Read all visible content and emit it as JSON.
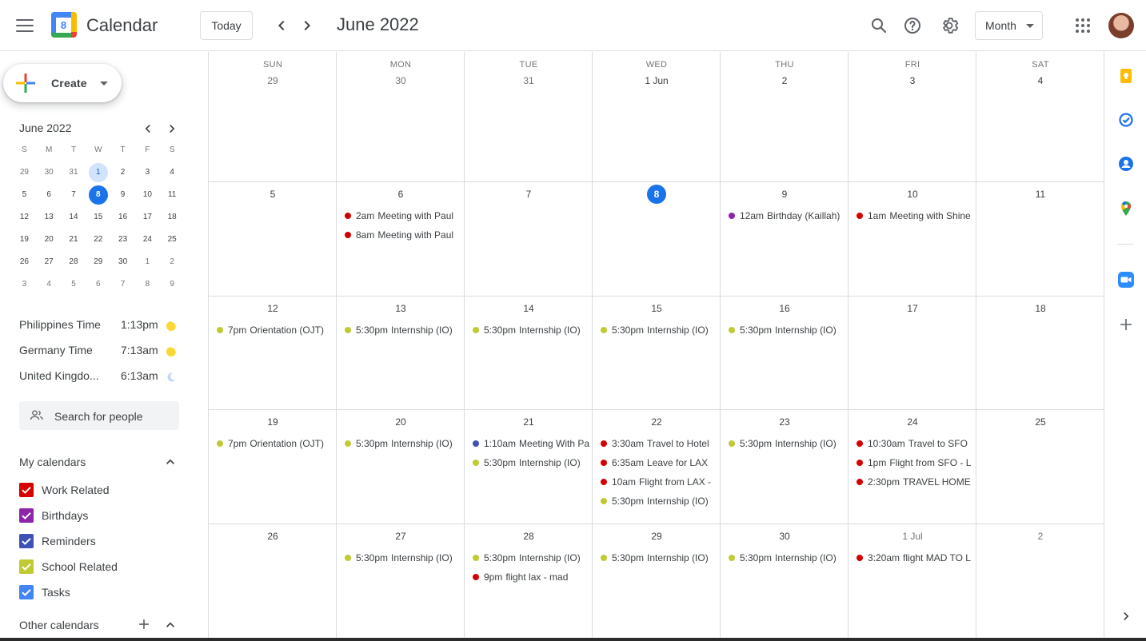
{
  "header": {
    "app_title": "Calendar",
    "logo_day": "8",
    "today_label": "Today",
    "month_title": "June 2022",
    "view_label": "Month"
  },
  "sidebar": {
    "create_label": "Create",
    "mini_calendar": {
      "title": "June 2022",
      "weekdays": [
        "S",
        "M",
        "T",
        "W",
        "T",
        "F",
        "S"
      ],
      "weeks": [
        [
          "29",
          "30",
          "31",
          "1",
          "2",
          "3",
          "4"
        ],
        [
          "5",
          "6",
          "7",
          "8",
          "9",
          "10",
          "11"
        ],
        [
          "12",
          "13",
          "14",
          "15",
          "16",
          "17",
          "18"
        ],
        [
          "19",
          "20",
          "21",
          "22",
          "23",
          "24",
          "25"
        ],
        [
          "26",
          "27",
          "28",
          "29",
          "30",
          "1",
          "2"
        ],
        [
          "3",
          "4",
          "5",
          "6",
          "7",
          "8",
          "9"
        ]
      ],
      "selected": "1",
      "today": "8"
    },
    "time_zones": [
      {
        "name": "Philippines Time",
        "time": "1:13pm",
        "icon": "sun-icon"
      },
      {
        "name": "Germany Time",
        "time": "7:13am",
        "icon": "sun-icon"
      },
      {
        "name": "United Kingdo...",
        "time": "6:13am",
        "icon": "moon-icon"
      }
    ],
    "search_people_placeholder": "Search for people",
    "my_calendars_title": "My calendars",
    "my_calendars": [
      {
        "name": "Work Related",
        "color": "#d50000"
      },
      {
        "name": "Birthdays",
        "color": "#8e24aa"
      },
      {
        "name": "Reminders",
        "color": "#3f51b5"
      },
      {
        "name": "School Related",
        "color": "#c0ca33"
      },
      {
        "name": "Tasks",
        "color": "#4285f4"
      }
    ],
    "other_calendars_title": "Other calendars"
  },
  "calendar": {
    "weekdays": [
      "SUN",
      "MON",
      "TUE",
      "WED",
      "THU",
      "FRI",
      "SAT"
    ],
    "weeks": [
      {
        "days": [
          {
            "label": "29",
            "other": true,
            "events": []
          },
          {
            "label": "30",
            "other": true,
            "events": []
          },
          {
            "label": "31",
            "other": true,
            "events": []
          },
          {
            "label": "1 Jun",
            "events": []
          },
          {
            "label": "2",
            "events": []
          },
          {
            "label": "3",
            "events": []
          },
          {
            "label": "4",
            "events": []
          }
        ]
      },
      {
        "days": [
          {
            "label": "5",
            "events": []
          },
          {
            "label": "6",
            "events": [
              {
                "time": "2am",
                "title": "Meeting with Paul",
                "color": "#d50000"
              },
              {
                "time": "8am",
                "title": "Meeting with Paul",
                "color": "#d50000"
              }
            ]
          },
          {
            "label": "7",
            "events": []
          },
          {
            "label": "8",
            "today": true,
            "events": []
          },
          {
            "label": "9",
            "events": [
              {
                "time": "12am",
                "title": "Birthday (Kaillah)",
                "color": "#8e24aa"
              }
            ]
          },
          {
            "label": "10",
            "events": [
              {
                "time": "1am",
                "title": "Meeting with Shine",
                "color": "#d50000"
              }
            ]
          },
          {
            "label": "11",
            "events": []
          }
        ]
      },
      {
        "days": [
          {
            "label": "12",
            "events": [
              {
                "time": "7pm",
                "title": "Orientation (OJT)",
                "color": "#c0ca33"
              }
            ]
          },
          {
            "label": "13",
            "events": [
              {
                "time": "5:30pm",
                "title": "Internship (IO)",
                "color": "#c0ca33"
              }
            ]
          },
          {
            "label": "14",
            "events": [
              {
                "time": "5:30pm",
                "title": "Internship (IO)",
                "color": "#c0ca33"
              }
            ]
          },
          {
            "label": "15",
            "events": [
              {
                "time": "5:30pm",
                "title": "Internship (IO)",
                "color": "#c0ca33"
              }
            ]
          },
          {
            "label": "16",
            "events": [
              {
                "time": "5:30pm",
                "title": "Internship (IO)",
                "color": "#c0ca33"
              }
            ]
          },
          {
            "label": "17",
            "events": []
          },
          {
            "label": "18",
            "events": []
          }
        ]
      },
      {
        "days": [
          {
            "label": "19",
            "events": [
              {
                "time": "7pm",
                "title": "Orientation (OJT)",
                "color": "#c0ca33"
              }
            ]
          },
          {
            "label": "20",
            "events": [
              {
                "time": "5:30pm",
                "title": "Internship (IO)",
                "color": "#c0ca33"
              }
            ]
          },
          {
            "label": "21",
            "events": [
              {
                "time": "1:10am",
                "title": "Meeting With Pa",
                "color": "#3f51b5"
              },
              {
                "time": "5:30pm",
                "title": "Internship (IO)",
                "color": "#c0ca33"
              }
            ]
          },
          {
            "label": "22",
            "events": [
              {
                "time": "3:30am",
                "title": "Travel to Hotel",
                "color": "#d50000"
              },
              {
                "time": "6:35am",
                "title": "Leave for LAX",
                "color": "#d50000"
              },
              {
                "time": "10am",
                "title": "Flight from LAX -",
                "color": "#d50000"
              },
              {
                "time": "5:30pm",
                "title": "Internship (IO)",
                "color": "#c0ca33"
              }
            ]
          },
          {
            "label": "23",
            "events": [
              {
                "time": "5:30pm",
                "title": "Internship (IO)",
                "color": "#c0ca33"
              }
            ]
          },
          {
            "label": "24",
            "events": [
              {
                "time": "10:30am",
                "title": "Travel to SFO",
                "color": "#d50000"
              },
              {
                "time": "1pm",
                "title": "Flight from SFO - L",
                "color": "#d50000"
              },
              {
                "time": "2:30pm",
                "title": "TRAVEL HOME",
                "color": "#d50000"
              }
            ]
          },
          {
            "label": "25",
            "events": []
          }
        ]
      },
      {
        "days": [
          {
            "label": "26",
            "events": []
          },
          {
            "label": "27",
            "events": [
              {
                "time": "5:30pm",
                "title": "Internship (IO)",
                "color": "#c0ca33"
              }
            ]
          },
          {
            "label": "28",
            "events": [
              {
                "time": "5:30pm",
                "title": "Internship (IO)",
                "color": "#c0ca33"
              },
              {
                "time": "9pm",
                "title": "flight lax - mad",
                "color": "#d50000"
              }
            ]
          },
          {
            "label": "29",
            "events": [
              {
                "time": "5:30pm",
                "title": "Internship (IO)",
                "color": "#c0ca33"
              }
            ]
          },
          {
            "label": "30",
            "events": [
              {
                "time": "5:30pm",
                "title": "Internship (IO)",
                "color": "#c0ca33"
              }
            ]
          },
          {
            "label": "1 Jul",
            "other": true,
            "events": [
              {
                "time": "3:20am",
                "title": "flight MAD TO L",
                "color": "#d50000"
              }
            ]
          },
          {
            "label": "2",
            "other": true,
            "events": []
          }
        ]
      }
    ]
  },
  "side_panel": {
    "icons": [
      "keep-icon",
      "tasks-icon",
      "contacts-icon",
      "maps-icon",
      "zoom-icon",
      "add-icon",
      "chevron-right-icon"
    ]
  }
}
